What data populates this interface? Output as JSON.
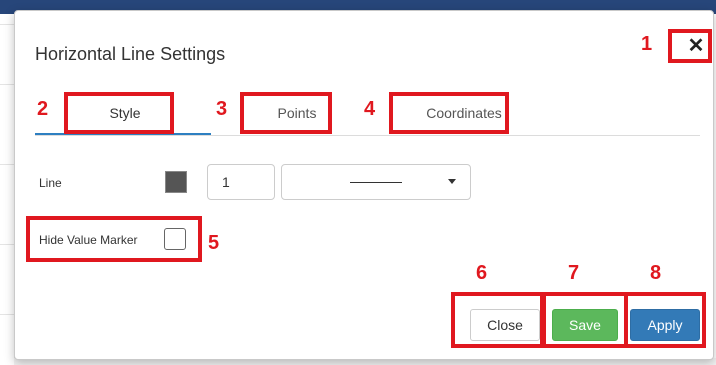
{
  "dialog": {
    "title": "Horizontal Line Settings",
    "close_icon": "✕"
  },
  "tabs": [
    {
      "label": "Style",
      "active": true
    },
    {
      "label": "Points",
      "active": false
    },
    {
      "label": "Coordinates",
      "active": false
    }
  ],
  "style_tab": {
    "line_label": "Line",
    "line_color": "#555555",
    "line_width_value": "1",
    "line_style": "solid",
    "hide_value_marker_label": "Hide Value Marker",
    "hide_value_marker_checked": false
  },
  "footer": {
    "close_label": "Close",
    "save_label": "Save",
    "apply_label": "Apply"
  },
  "colors": {
    "accent": "#2d7fc1",
    "save": "#5cb85c",
    "apply": "#337ab7",
    "annotation": "#e0181f"
  },
  "annotations": [
    "1",
    "2",
    "3",
    "4",
    "5",
    "6",
    "7",
    "8"
  ]
}
